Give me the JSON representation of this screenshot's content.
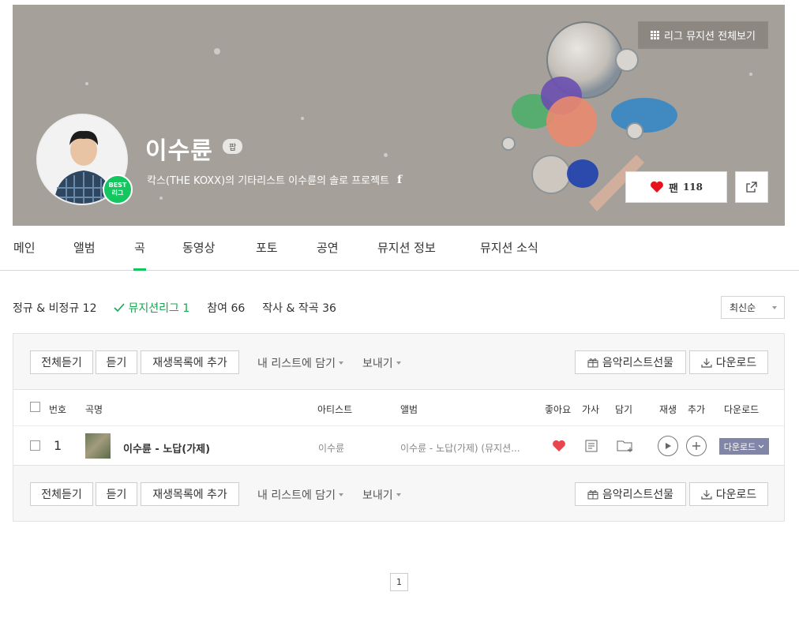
{
  "hero": {
    "all_musicians_label": "리그 뮤지션 전체보기",
    "artist_name": "이수륜",
    "genre_badge": "팝",
    "best_badge_line1": "BEST",
    "best_badge_line2": "리그",
    "description": "칵스(THE KOXX)의 기타리스트 이수륜의 솔로 프로젝트",
    "facebook_icon": "f",
    "fan_label": "팬",
    "fan_count": "118",
    "background_color": "#a5a19a"
  },
  "tabs": [
    {
      "label": "메인"
    },
    {
      "label": "앨범"
    },
    {
      "label": "곡",
      "active": true
    },
    {
      "label": "동영상"
    },
    {
      "label": "포토"
    },
    {
      "label": "공연"
    },
    {
      "label": "뮤지션 정보"
    },
    {
      "label": "뮤지션 소식"
    }
  ],
  "filters": {
    "items": [
      {
        "label": "정규 & 비정규 12"
      },
      {
        "label": "뮤지션리그 1",
        "selected": true
      },
      {
        "label": "참여 66"
      },
      {
        "label": "작사 & 작곡 36"
      }
    ],
    "sort_label": "최신순"
  },
  "toolbar": {
    "play_all": "전체듣기",
    "play": "듣기",
    "add_playlist": "재생목록에 추가",
    "save_mylist": "내 리스트에 담기",
    "send": "보내기",
    "gift": "음악리스트선물",
    "download": "다운로드"
  },
  "table": {
    "headers": {
      "number": "번호",
      "title": "곡명",
      "artist": "아티스트",
      "album": "앨범",
      "like": "좋아요",
      "lyrics": "가사",
      "save": "담기",
      "play": "재생",
      "add": "추가",
      "download": "다운로드"
    },
    "rows": [
      {
        "number": "1",
        "title": "이수륜 - 노답(가제)",
        "artist": "이수륜",
        "album": "이수륜 - 노답(가제) (뮤지션...",
        "download_label": "다운로드"
      }
    ]
  },
  "pagination": {
    "current": "1"
  },
  "colors": {
    "accent": "#14c65f",
    "accent_text": "#14a851",
    "heart": "#e8454f",
    "download_button": "#8185a8"
  }
}
